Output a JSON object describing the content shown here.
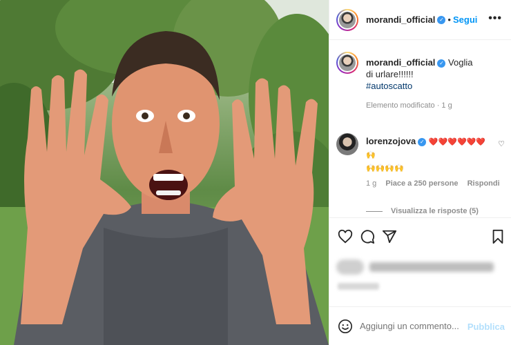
{
  "post": {
    "username": "morandi_official",
    "follow_label": "Segui",
    "dot": "•",
    "more_label": "•••"
  },
  "caption": {
    "username": "morandi_official",
    "text": "Voglia di urlare!!!!!!",
    "hashtag": "#autoscatto",
    "meta": "Elemento modificato · 1 g"
  },
  "comment": {
    "username": "lorenzojova",
    "text_line1": "❤️❤️❤️❤️❤️❤️🙌",
    "text_line2": "🙌🙌🙌🙌",
    "age": "1 g",
    "likes": "Piace a 250 persone",
    "reply_label": "Rispondi",
    "view_replies": "Visualizza le risposte (5)"
  },
  "actions": {
    "icons": [
      "heart-icon",
      "comment-icon",
      "share-icon",
      "bookmark-icon"
    ]
  },
  "add_comment": {
    "placeholder": "Aggiungi un commento...",
    "post_label": "Pubblica"
  },
  "colors": {
    "link": "#0095f6",
    "verified": "#3897f0",
    "muted": "#8e8e8e",
    "post_disabled": "#b2dffc"
  }
}
